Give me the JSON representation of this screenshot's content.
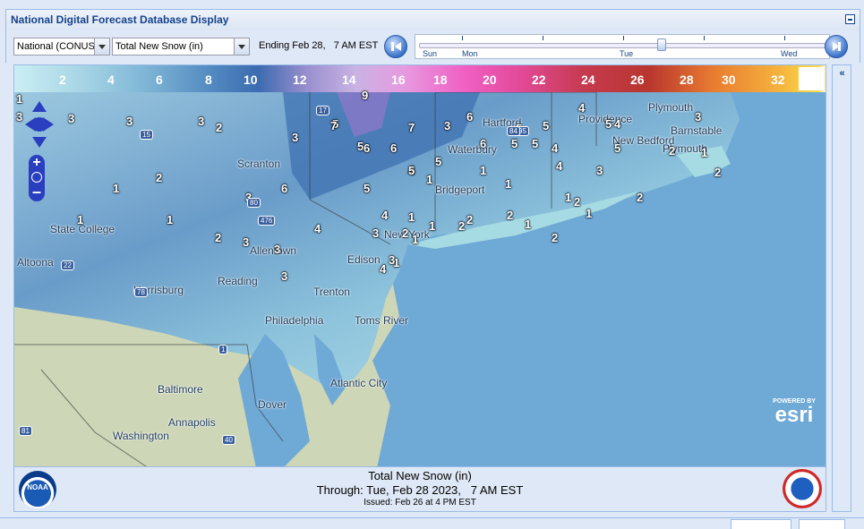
{
  "window": {
    "title": "National Digital Forecast Database Display"
  },
  "toolbar": {
    "region_select": "National (CONUS",
    "element_select": "Total New Snow (in)",
    "ending_text": "Ending Feb 28,   7 AM EST",
    "timeline_days": [
      "Sun",
      "Mon",
      "Tue",
      "Wed"
    ]
  },
  "legend": {
    "labels": [
      "2",
      "4",
      "6",
      "8",
      "10",
      "12",
      "14",
      "16",
      "18",
      "20",
      "22",
      "24",
      "26",
      "28",
      "30",
      "32"
    ]
  },
  "map": {
    "cities": [
      {
        "name": "Hartford"
      },
      {
        "name": "Providence"
      },
      {
        "name": "Plymouth"
      },
      {
        "name": "Barnstable"
      },
      {
        "name": "New Bedford"
      },
      {
        "name": "Plymouth"
      },
      {
        "name": "Waterbury"
      },
      {
        "name": "Bridgeport"
      },
      {
        "name": "Scranton"
      },
      {
        "name": "State College"
      },
      {
        "name": "Altoona"
      },
      {
        "name": "Allentown"
      },
      {
        "name": "Edison"
      },
      {
        "name": "New York"
      },
      {
        "name": "Harrisburg"
      },
      {
        "name": "Reading"
      },
      {
        "name": "Trenton"
      },
      {
        "name": "Philadelphia"
      },
      {
        "name": "Toms River"
      },
      {
        "name": "Atlantic City"
      },
      {
        "name": "Baltimore"
      },
      {
        "name": "Dover"
      },
      {
        "name": "Annapolis"
      },
      {
        "name": "Washington"
      }
    ],
    "snow_values": [
      "1",
      "3",
      "3",
      "3",
      "3",
      "1",
      "2",
      "1",
      "1",
      "2",
      "3",
      "3",
      "3",
      "3",
      "6",
      "5",
      "7",
      "5",
      "4",
      "6",
      "6",
      "4",
      "5",
      "4",
      "5",
      "5",
      "6",
      "6",
      "5",
      "5",
      "4",
      "4",
      "4",
      "5",
      "5",
      "3",
      "3",
      "2",
      "2",
      "2",
      "2",
      "1",
      "1",
      "1",
      "1",
      "1",
      "1",
      "1",
      "1",
      "2",
      "2",
      "2",
      "2",
      "1",
      "1",
      "2",
      "4",
      "3",
      "3",
      "5",
      "4",
      "3",
      "2",
      "1",
      "5",
      "7",
      "9",
      "3"
    ],
    "highway_shields": [
      "17",
      "15",
      "80",
      "476",
      "22",
      "78",
      "1",
      "95",
      "40",
      "81",
      "84"
    ],
    "esri_label_top": "POWERED BY",
    "esri_label": "esri"
  },
  "footer": {
    "title": "Total New Snow (in)",
    "through": "Through: Tue, Feb 28 2023,   7 AM EST",
    "issued": "Issued: Feb 26 at 4 PM EST",
    "noaa_logo": "NOAA",
    "nws_logo": "NATIONAL WEATHER SERVICE"
  },
  "colors": {
    "ocean": "#6fa9d6",
    "panel": "#dfe8f6",
    "header_text": "#15428b"
  }
}
